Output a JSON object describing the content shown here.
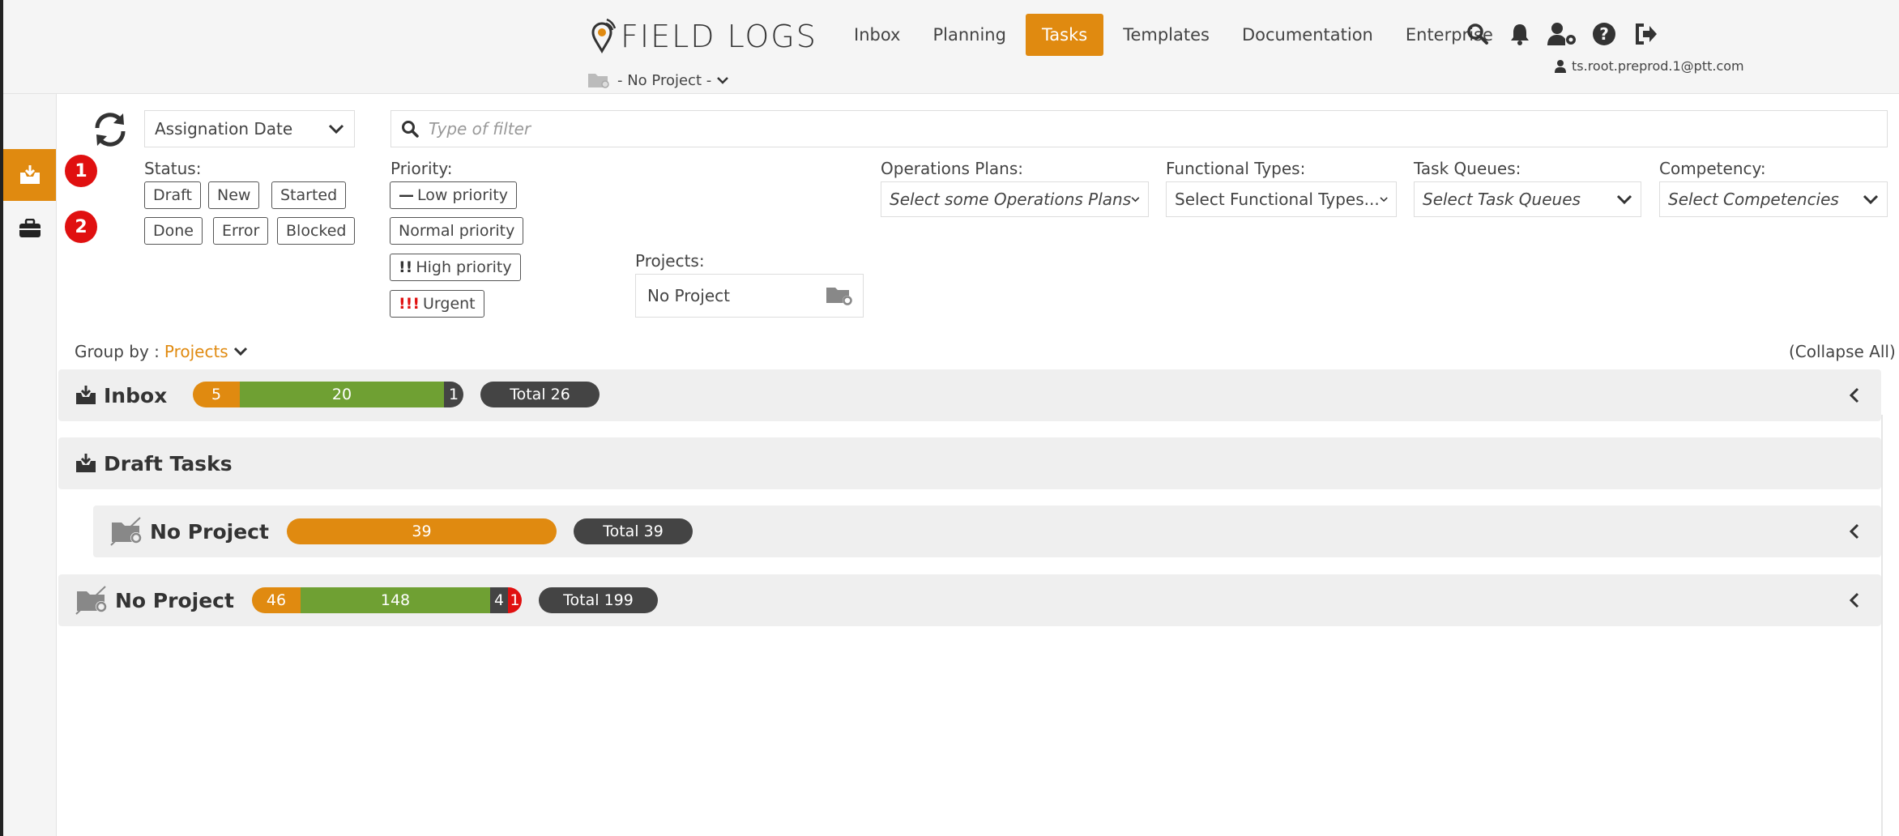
{
  "app": {
    "logo_text": "FIELD LOGS",
    "project_selector": "- No Project -",
    "user_email": "ts.root.preprod.1@ptt.com"
  },
  "nav": {
    "items": [
      "Inbox",
      "Planning",
      "Tasks",
      "Templates",
      "Documentation",
      "Enterprise"
    ],
    "active": "Tasks"
  },
  "sidebar": {
    "badges": [
      "1",
      "2"
    ]
  },
  "filters": {
    "sort_by": "Assignation Date",
    "filter_placeholder": "Type of filter",
    "status_label": "Status:",
    "statuses": [
      "Draft",
      "New",
      "Started",
      "Done",
      "Error",
      "Blocked"
    ],
    "priority_label": "Priority:",
    "priorities": [
      "Low priority",
      "Normal priority",
      "High priority",
      "Urgent"
    ],
    "projects_label": "Projects:",
    "projects_value": "No Project",
    "operations_plans_label": "Operations Plans:",
    "operations_plans_placeholder": "Select some Operations Plans",
    "functional_types_label": "Functional Types:",
    "functional_types_placeholder": "Select Functional Types...",
    "task_queues_label": "Task Queues:",
    "task_queues_placeholder": "Select Task Queues",
    "competency_label": "Competency:",
    "competency_placeholder": "Select Competencies"
  },
  "groupby": {
    "label": "Group by :",
    "value": "Projects",
    "collapse_all": "(Collapse All)"
  },
  "colors": {
    "accent": "#e08a10",
    "green": "#6fa033",
    "dark": "#444444",
    "red": "#e01010"
  },
  "groups": [
    {
      "title": "Inbox",
      "counts": [
        "5",
        "20",
        "1"
      ],
      "total": "Total 26"
    },
    {
      "title": "Draft Tasks"
    },
    {
      "title": "No Project",
      "counts": [
        "39"
      ],
      "total": "Total 39"
    },
    {
      "title": "No Project",
      "counts": [
        "46",
        "148",
        "4",
        "1"
      ],
      "total": "Total 199"
    }
  ]
}
